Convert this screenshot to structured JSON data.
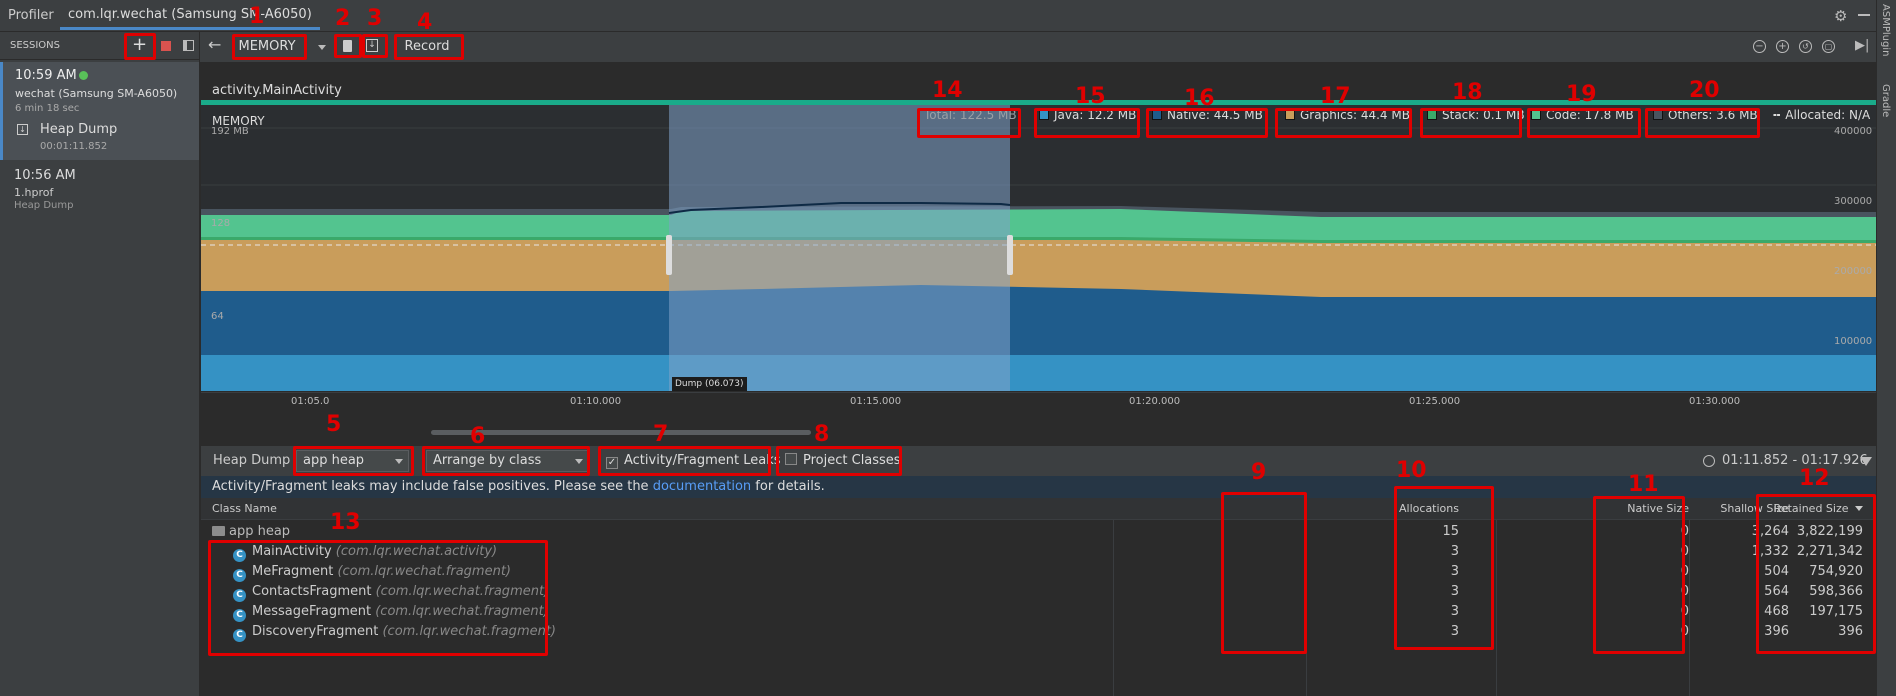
{
  "tabs": {
    "profiler": "Profiler",
    "session_tab": "com.lqr.wechat (Samsung SM-A6050)"
  },
  "sidebar": {
    "title": "SESSIONS",
    "session1": {
      "time": "10:59 AM",
      "device": "wechat (Samsung SM-A6050)",
      "duration": "6 min 18 sec"
    },
    "heap_item": {
      "label": "Heap Dump",
      "time": "00:01:11.852"
    },
    "session2": {
      "time": "10:56 AM",
      "file": "1.hprof",
      "kind": "Heap Dump"
    }
  },
  "toolbar": {
    "profiler_select": "MEMORY",
    "record_label": "Record"
  },
  "right_strip": {
    "asm": "ASMPlugin",
    "gradle": "Gradle"
  },
  "chart_header": {
    "activity": "activity.MainActivity",
    "memory_label": "MEMORY"
  },
  "legend": {
    "total": "Total: 122.5 MB",
    "java": "Java: 12.2 MB",
    "native": "Native: 44.5 MB",
    "graphics": "Graphics: 44.4 MB",
    "stack": "Stack: 0.1 MB",
    "code": "Code: 17.8 MB",
    "others": "Others: 3.6 MB",
    "allocated": "Allocated: N/A"
  },
  "colors": {
    "java": "#3592c4",
    "native": "#1f5c8c",
    "graphics": "#c99d5b",
    "stack": "#3aa96a",
    "code": "#53c48f",
    "others": "#49545f",
    "selection": "#6b8bad",
    "accent_bar": "#1aab8a"
  },
  "chart_data": {
    "type": "area",
    "left_axis_ticks": [
      "192 MB",
      "128",
      "64"
    ],
    "right_axis_ticks": [
      "400000",
      "300000",
      "200000",
      "100000"
    ],
    "x_ticks": [
      "01:05.0",
      "01:10.000",
      "01:15.000",
      "01:20.000",
      "01:25.000",
      "01:30.000"
    ],
    "selection_label": "Dump (06.073)"
  },
  "heap_toolbar": {
    "label": "Heap Dump",
    "heap_select": "app heap",
    "arrange_select": "Arrange by class",
    "leaks_label": "Activity/Fragment Leaks",
    "project_label": "Project Classes",
    "range": "01:11.852 - 01:17.926"
  },
  "banner": {
    "pre": "Activity/Fragment leaks may include false positives. Please see the ",
    "link": "documentation",
    "post": " for details."
  },
  "table": {
    "headers": {
      "class_name": "Class Name",
      "allocations": "Allocations",
      "native_size": "Native Size",
      "shallow_size": "Shallow Size",
      "retained_size": "Retained Size"
    },
    "group": {
      "name": "app heap",
      "allocations": "15",
      "native": "0",
      "shallow": "3,264",
      "retained": "3,822,199"
    },
    "rows": [
      {
        "name": "MainActivity",
        "pkg": "(com.lqr.wechat.activity)",
        "allocations": "3",
        "native": "0",
        "shallow": "1,332",
        "retained": "2,271,342"
      },
      {
        "name": "MeFragment",
        "pkg": "(com.lqr.wechat.fragment)",
        "allocations": "3",
        "native": "0",
        "shallow": "504",
        "retained": "754,920"
      },
      {
        "name": "ContactsFragment",
        "pkg": "(com.lqr.wechat.fragment)",
        "allocations": "3",
        "native": "0",
        "shallow": "564",
        "retained": "598,366"
      },
      {
        "name": "MessageFragment",
        "pkg": "(com.lqr.wechat.fragment)",
        "allocations": "3",
        "native": "0",
        "shallow": "468",
        "retained": "197,175"
      },
      {
        "name": "DiscoveryFragment",
        "pkg": "(com.lqr.wechat.fragment)",
        "allocations": "3",
        "native": "0",
        "shallow": "396",
        "retained": "396"
      }
    ]
  },
  "annotations": [
    "1",
    "2",
    "3",
    "4",
    "5",
    "6",
    "7",
    "8",
    "9",
    "10",
    "11",
    "12",
    "13",
    "14",
    "15",
    "16",
    "17",
    "18",
    "19",
    "20"
  ]
}
